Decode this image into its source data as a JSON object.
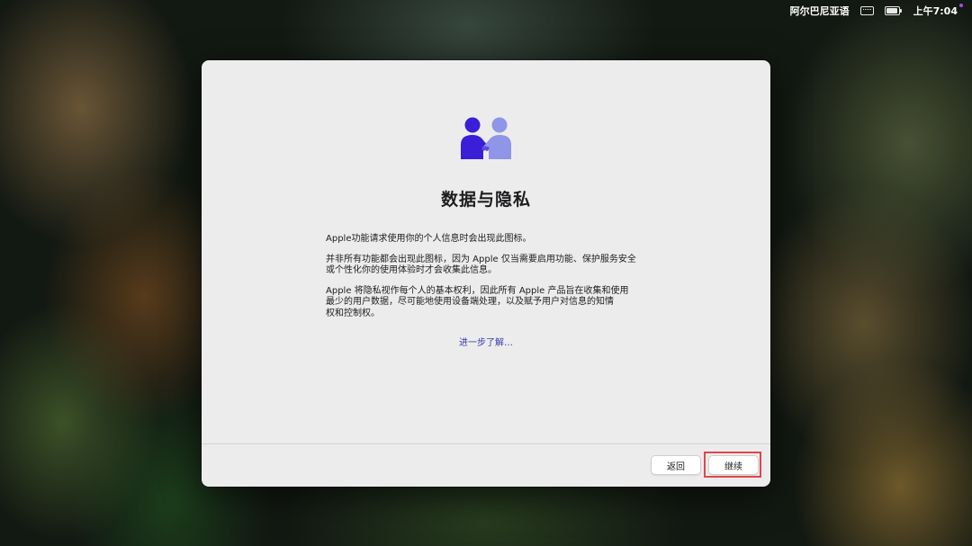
{
  "menubar": {
    "input_source": "阿尔巴尼亚语",
    "time": "上午7:04",
    "icons": [
      "keyboard-icon",
      "battery-charging-icon"
    ]
  },
  "dialog": {
    "title": "数据与隐私",
    "paragraphs": [
      "Apple功能请求使用你的个人信息时会出现此图标。",
      "并非所有功能都会出现此图标，因为 Apple 仅当需要启用功能、保护服务安全\n或个性化你的使用体验时才会收集此信息。",
      "Apple 将隐私视作每个人的基本权利，因此所有 Apple 产品旨在收集和使用\n最少的用户数据，尽可能地使用设备端处理，以及赋予用户对信息的知情\n权和控制权。"
    ],
    "learn_more": "进一步了解…",
    "hero_icon": "privacy-handshake-icon",
    "buttons": {
      "back": "返回",
      "continue": "继续"
    }
  },
  "colors": {
    "icon_dark": "#3a1fd6",
    "icon_light": "#8f96e8",
    "link": "#3a3aa8",
    "highlight": "#e0474c"
  }
}
